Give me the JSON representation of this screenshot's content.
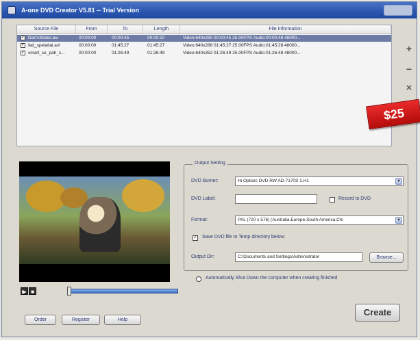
{
  "window": {
    "title": "A-one DVD Creator V5.81 -- Trial Version"
  },
  "file_list": {
    "columns": [
      "Source File",
      "From",
      "To",
      "Length",
      "File Information"
    ],
    "rows": [
      {
        "checked": true,
        "name": "Dan'sSlides.avi",
        "from": "00:00:00",
        "to": "00:00:45",
        "length": "00:00:10",
        "info": "Video:640x280 00:00:45 25.00FPS Audio:00:00:48 48000...",
        "selected": true
      },
      {
        "checked": true,
        "name": "fad_spelaltai.avi",
        "from": "00:00:00",
        "to": "01:45:27",
        "length": "01:45:27",
        "info": "Video:640x288 01:45:27 25.00FPS Audio:01:45:28 48000...",
        "selected": false
      },
      {
        "checked": true,
        "name": "smart_se_pah_s...",
        "from": "00:00:00",
        "to": "01:26:49",
        "length": "01:26:49",
        "info": "Video:640x352 01:26:49 25.00FPS Audio:01:26:48 48000...",
        "selected": false
      }
    ]
  },
  "side_buttons": {
    "add": "+",
    "remove": "−",
    "clear": "✕",
    "up": "▲"
  },
  "price_badge": "$25",
  "player": {
    "play": "▶",
    "stop": "■"
  },
  "output": {
    "group_title": "Output Setting",
    "dvd_burner_label": "DVD Burner:",
    "dvd_burner_value": "Hi Optiarc DVD RW AD-7170S 1.H1",
    "dvd_label_label": "DVD Label:",
    "dvd_label_value": "",
    "record_to_dvd": "Record to DVD",
    "format_label": "Format:",
    "format_value": "PAL (720 x 576) (Australia,Europe,South America,Chi",
    "save_temp": "Save DVD file to Temp directory below:",
    "output_dir_label": "Output Dir:",
    "output_dir_value": "C:\\Documents and Settings\\Administrator",
    "browse": "Browse..."
  },
  "auto_shutdown": "Automatically Shut Down the computer when creating finished",
  "bottom": {
    "order": "Order",
    "register": "Register",
    "help": "Help",
    "create": "Create"
  }
}
